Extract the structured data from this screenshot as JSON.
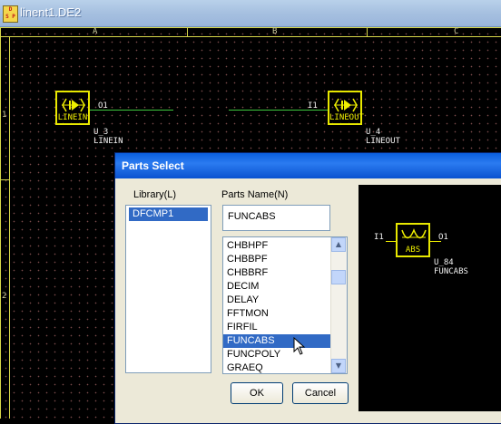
{
  "document": {
    "title": "linent1.DE2",
    "icon": "dsp-app-icon",
    "icon_text": [
      "D",
      "S P"
    ]
  },
  "schematic": {
    "columns": [
      "A",
      "B",
      "C"
    ],
    "rows": [
      "1",
      "2"
    ],
    "components": [
      {
        "box_label": "LINEIN",
        "pin": "O1",
        "ref": "U_3",
        "type": "LINEIN"
      },
      {
        "box_label": "LINEOUT",
        "pin": "I1",
        "ref": "U_4",
        "type": "LINEOUT"
      }
    ]
  },
  "dialog": {
    "title": "Parts Select",
    "library_label": "Library(L)",
    "library_items": [
      "DFCMP1"
    ],
    "parts_name_label": "Parts Name(N)",
    "parts_name_value": "FUNCABS",
    "parts": [
      "CHBHPF",
      "CHBBPF",
      "CHBBRF",
      "DECIM",
      "DELAY",
      "FFTMON",
      "FIRFIL",
      "FUNCABS",
      "FUNCPOLY",
      "GRAEQ"
    ],
    "selected_part": "FUNCABS",
    "ok_label": "OK",
    "cancel_label": "Cancel",
    "preview": {
      "box_label": "ABS",
      "in_pin": "I1",
      "out_pin": "O1",
      "ref": "U_84",
      "type": "FUNCABS"
    }
  },
  "colors": {
    "canvas": "#000000",
    "component": "#e8e800",
    "wire": "#3ec93e",
    "selection": "#316ac5",
    "titlebar": "#0a5fde"
  }
}
